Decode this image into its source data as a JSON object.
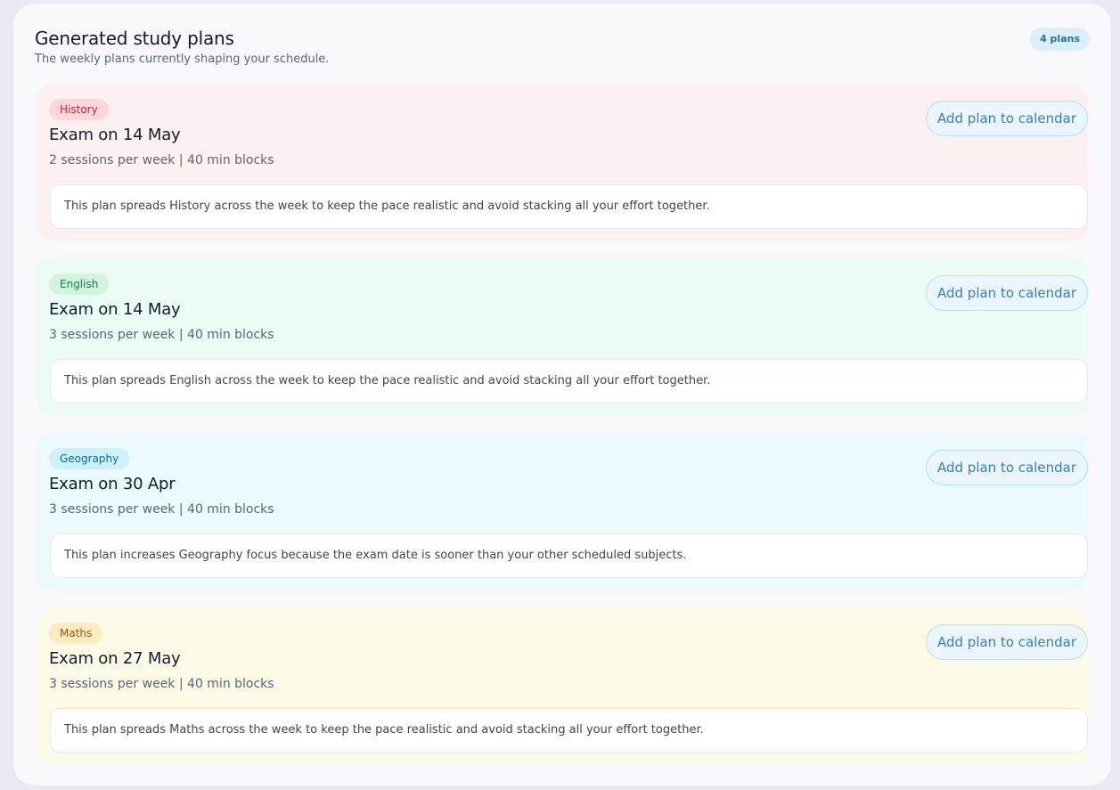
{
  "header": {
    "title": "Generated study plans",
    "subtitle": "The weekly plans currently shaping your schedule.",
    "count_badge": "4 plans"
  },
  "plans": [
    {
      "subject": "History",
      "exam": "Exam on 14 May",
      "meta": "2 sessions per week | 40 min blocks",
      "button_label": "Add plan to calendar",
      "note": "This plan spreads History across the week to keep the pace realistic and avoid stacking all your effort together.",
      "tone_color": "#fdf0f0"
    },
    {
      "subject": "English",
      "exam": "Exam on 14 May",
      "meta": "3 sessions per week | 40 min blocks",
      "button_label": "Add plan to calendar",
      "note": "This plan spreads English across the week to keep the pace realistic and avoid stacking all your effort together.",
      "tone_color": "#ecfbf3"
    },
    {
      "subject": "Geography",
      "exam": "Exam on 30 Apr",
      "meta": "3 sessions per week | 40 min blocks",
      "button_label": "Add plan to calendar",
      "note": "This plan increases Geography focus because the exam date is sooner than your other scheduled subjects.",
      "tone_color": "#ecf9fd"
    },
    {
      "subject": "Maths",
      "exam": "Exam on 27 May",
      "meta": "3 sessions per week | 40 min blocks",
      "button_label": "Add plan to calendar",
      "note": "This plan spreads Maths across the week to keep the pace realistic and avoid stacking all your effort together.",
      "tone_color": "#fdfbe8"
    }
  ]
}
